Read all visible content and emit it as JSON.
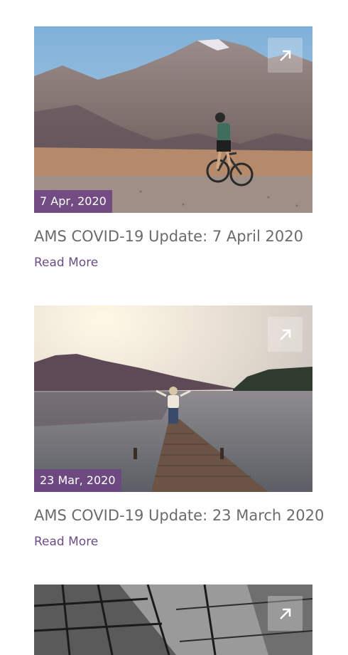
{
  "posts": [
    {
      "date": "7 Apr, 2020",
      "title": "AMS COVID-19 Update: 7 April 2020",
      "read_more": "Read More",
      "icon": "arrow-up-right-icon"
    },
    {
      "date": "23 Mar, 2020",
      "title": "AMS COVID-19 Update: 23 March 2020",
      "read_more": "Read More",
      "icon": "arrow-up-right-icon"
    },
    {
      "icon": "arrow-up-right-icon"
    }
  ],
  "colors": {
    "accent": "#6d4d86",
    "badge_bg": "#6e4682",
    "title_text": "#6b6b6b"
  }
}
